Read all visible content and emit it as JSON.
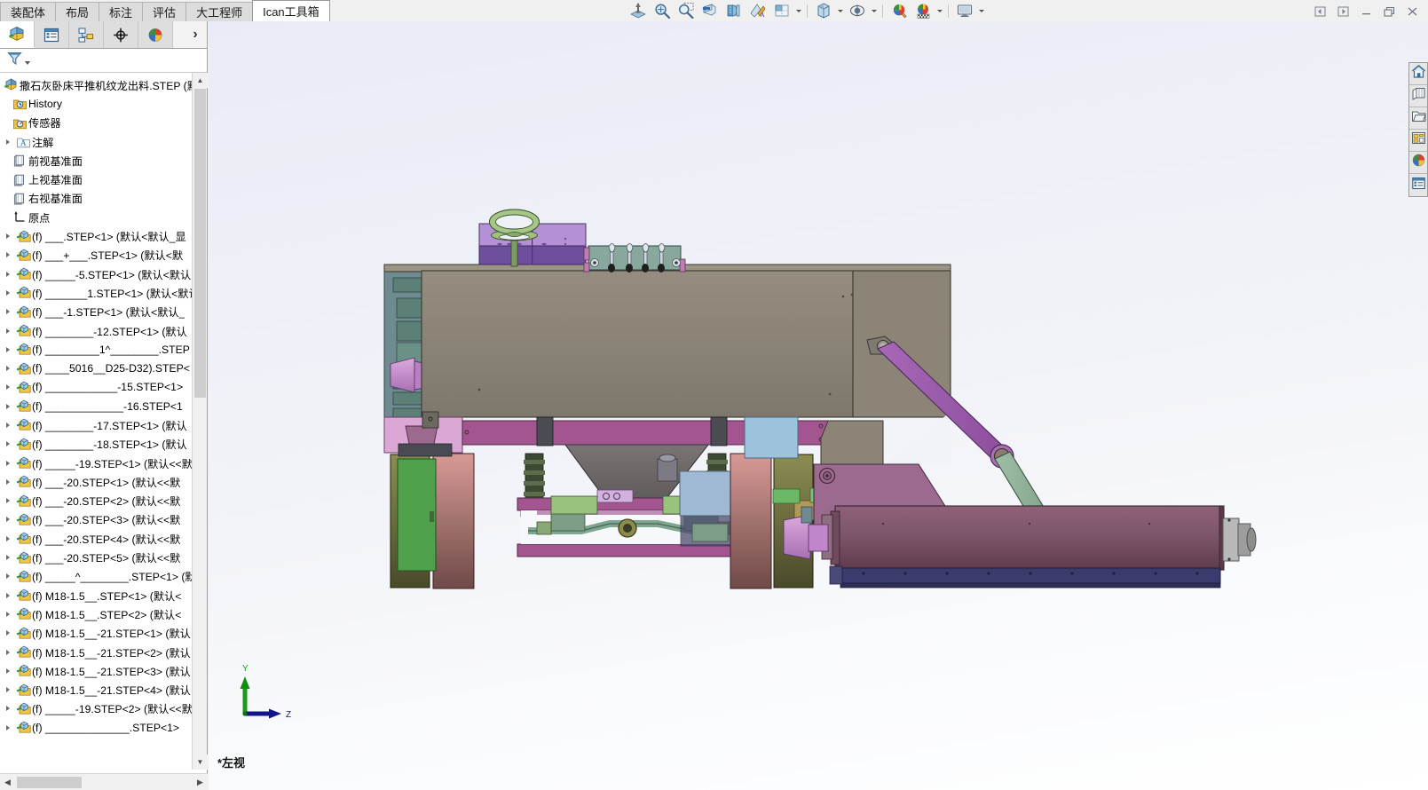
{
  "window": {
    "controls": [
      {
        "name": "prev-doc-button",
        "glyph": "◁"
      },
      {
        "name": "next-doc-button",
        "glyph": "▷"
      },
      {
        "name": "minimize-button",
        "glyph": "—"
      },
      {
        "name": "restore-button",
        "glyph": "❐"
      },
      {
        "name": "close-button",
        "glyph": "✕"
      }
    ]
  },
  "ribbon": {
    "tabs": [
      {
        "label": "装配体",
        "active": false
      },
      {
        "label": "布局",
        "active": false
      },
      {
        "label": "标注",
        "active": false
      },
      {
        "label": "评估",
        "active": false
      },
      {
        "label": "大工程师",
        "active": false
      },
      {
        "label": "Ican工具箱",
        "active": true
      }
    ]
  },
  "head_toolbar": {
    "items": [
      {
        "name": "mate-icon",
        "label": "配合"
      },
      {
        "name": "zoom-to-fit-icon",
        "label": "整屏显示全图"
      },
      {
        "name": "zoom-to-area-icon",
        "label": "局部放大"
      },
      {
        "name": "section-view-icon",
        "label": "剖面视图"
      },
      {
        "name": "view-orientation-icon",
        "label": "视图定向"
      },
      {
        "name": "display-style-icon",
        "label": "显示样式"
      },
      {
        "name": "hide-show-icon",
        "label": "隐藏/显示项目"
      },
      {
        "name": "appearance-icon",
        "label": "编辑外观"
      },
      {
        "name": "scene-icon",
        "label": "应用布景"
      },
      {
        "name": "view-settings-icon",
        "label": "视图设定"
      }
    ]
  },
  "featuremanager": {
    "tabs": [
      {
        "name": "tab-feature-tree",
        "icon": "assembly-tree-icon",
        "selected": true
      },
      {
        "name": "tab-property-manager",
        "icon": "property-manager-icon",
        "selected": false
      },
      {
        "name": "tab-configuration-manager",
        "icon": "configuration-icon",
        "selected": false
      },
      {
        "name": "tab-dimxpert-manager",
        "icon": "dimxpert-icon",
        "selected": false
      },
      {
        "name": "tab-display-manager",
        "icon": "display-manager-icon",
        "selected": false
      }
    ],
    "more_glyph": "›",
    "filter_icon": "filter-icon"
  },
  "tree": {
    "root": "撒石灰卧床平推机纹龙出料.STEP  (默",
    "header_items": [
      {
        "label": "History",
        "icon": "history-icon",
        "arrow": false,
        "indent": 1
      },
      {
        "label": "传感器",
        "icon": "sensors-icon",
        "arrow": false,
        "indent": 1
      },
      {
        "label": "注解",
        "icon": "annotations-icon",
        "arrow": true,
        "indent": 1
      },
      {
        "label": "前视基准面",
        "icon": "plane-icon",
        "arrow": false,
        "indent": 1
      },
      {
        "label": "上视基准面",
        "icon": "plane-icon",
        "arrow": false,
        "indent": 1
      },
      {
        "label": "右视基准面",
        "icon": "plane-icon",
        "arrow": false,
        "indent": 1
      },
      {
        "label": "原点",
        "icon": "origin-icon",
        "arrow": false,
        "indent": 1
      }
    ],
    "components": [
      "(f) ___.STEP<1>  (默认<默认_显",
      "(f) ___+___.STEP<1>  (默认<默",
      "(f) _____-5.STEP<1>  (默认<默认",
      "(f) _______1.STEP<1>  (默认<默认",
      "(f) ___-1.STEP<1>  (默认<默认_",
      "(f) ________-12.STEP<1>  (默认",
      "(f) _________1^________.STEP",
      "(f) ____5016__D25-D32).STEP<",
      "(f) ____________-15.STEP<1>",
      "(f) _____________-16.STEP<1",
      "(f) ________-17.STEP<1>  (默认",
      "(f) ________-18.STEP<1>  (默认",
      "(f) _____-19.STEP<1>  (默认<<默",
      "(f) ___-20.STEP<1>  (默认<<默",
      "(f) ___-20.STEP<2>  (默认<<默",
      "(f) ___-20.STEP<3>  (默认<<默",
      "(f) ___-20.STEP<4>  (默认<<默",
      "(f) ___-20.STEP<5>  (默认<<默",
      "(f) _____^________.STEP<1>  (默",
      "(f) M18-1.5__.STEP<1>  (默认<",
      "(f) M18-1.5__.STEP<2>  (默认<",
      "(f) M18-1.5__-21.STEP<1>  (默认",
      "(f) M18-1.5__-21.STEP<2>  (默认",
      "(f) M18-1.5__-21.STEP<3>  (默认",
      "(f) M18-1.5__-21.STEP<4>  (默认",
      "(f) _____-19.STEP<2>  (默认<<默",
      "(f) ______________.STEP<1>"
    ]
  },
  "graphics": {
    "view_label": "*左视",
    "triad": {
      "y_axis": "Y",
      "z_axis": "Z"
    }
  },
  "task_pane": {
    "buttons": [
      {
        "name": "solidworks-resources-button",
        "icon": "home-icon"
      },
      {
        "name": "design-library-button",
        "icon": "library-icon"
      },
      {
        "name": "file-explorer-button",
        "icon": "folder-icon"
      },
      {
        "name": "view-palette-button",
        "icon": "view-palette-icon"
      },
      {
        "name": "appearances-scenes-button",
        "icon": "appearances-icon"
      },
      {
        "name": "custom-properties-button",
        "icon": "custom-properties-icon"
      }
    ]
  },
  "model_colors": {
    "body_taupe": "#8d8679",
    "cab_light_purple": "#b28fd4",
    "cab_dark_purple": "#6e4f9e",
    "steering_green": "#8fae72",
    "panel_teal": "#88a89e",
    "frame_magenta": "#a3558f",
    "chute_pink": "#d9a5d2",
    "wheel_salmon": "#c98f8c",
    "wheel_olive": "#7d7f46",
    "tank_green": "#63a85d",
    "auger_maroon": "#80566b",
    "auger_base_navy": "#3b3b6e",
    "cylinder_purple": "#9b5aa8",
    "link_green": "#8fae96",
    "hopper_gray": "#706a6a",
    "box_blue": "#9dc2dc",
    "shaft_gold": "#b09a5a",
    "hub_orchid": "#c98fd1"
  }
}
